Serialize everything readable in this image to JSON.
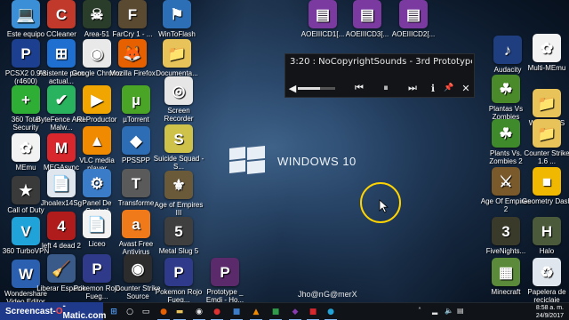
{
  "wallpaper": {
    "wordmark": "WINDOWS 10"
  },
  "media_widget": {
    "title": "3:20 : NoCopyrightSounds - 3rd Prototype &",
    "volume_fraction": 0.6
  },
  "watermark_names": [
    "Jho@n",
    "G@merX"
  ],
  "screencast_badge": {
    "prefix": "Screencast-",
    "o": "O",
    "suffix": "-Matic.com"
  },
  "clock": {
    "time": "8:58 a. m.",
    "date": "24/9/2017"
  },
  "icons": [
    {
      "id": "este-equipo",
      "label": "Este equipo",
      "color": "#3b8fd6",
      "glyph": "💻"
    },
    {
      "id": "ccleaner",
      "label": "CCleaner",
      "color": "#c0392b",
      "glyph": "C"
    },
    {
      "id": "area-51",
      "label": "Area-51",
      "color": "#2a3d2a",
      "glyph": "☠"
    },
    {
      "id": "farcry",
      "label": "FarCry 1 - ...",
      "color": "#5b4a32",
      "glyph": "F"
    },
    {
      "id": "wintoflash",
      "label": "WinToFlash",
      "color": "#2d6fb7",
      "glyph": "⚑"
    },
    {
      "id": "pcsx2",
      "label": "PCSX2 0.9.8 (r4600)",
      "color": "#1c3f8f",
      "glyph": "P"
    },
    {
      "id": "asistente",
      "label": "Asistente para actual...",
      "color": "#1f6fd0",
      "glyph": "⊞"
    },
    {
      "id": "google-chrome",
      "label": "Google Chrome",
      "color": "#e9e9e9",
      "glyph": "◉"
    },
    {
      "id": "mozilla-firefox",
      "label": "Mozilla Firefox",
      "color": "#e66000",
      "glyph": "🦊"
    },
    {
      "id": "documentos",
      "label": "Documenta...",
      "color": "#e8c35a",
      "glyph": "📁"
    },
    {
      "id": "360-total-security",
      "label": "360 Total Security",
      "color": "#2fae36",
      "glyph": "+"
    },
    {
      "id": "bytefence",
      "label": "ByteFence Anti-Malw...",
      "color": "#2ab35e",
      "glyph": "✔"
    },
    {
      "id": "reproductor",
      "label": "ReProductor",
      "color": "#f0a500",
      "glyph": "▶"
    },
    {
      "id": "utorrent",
      "label": "µTorrent",
      "color": "#4aa527",
      "glyph": "µ"
    },
    {
      "id": "screen-recorder",
      "label": "Screen Recorder",
      "color": "#e6e6e6",
      "glyph": "◎"
    },
    {
      "id": "memu",
      "label": "MEmu",
      "color": "#f2f2f2",
      "glyph": "✿"
    },
    {
      "id": "megasync",
      "label": "MEGAsync",
      "color": "#d9272e",
      "glyph": "M"
    },
    {
      "id": "vlc",
      "label": "VLC media player",
      "color": "#f08a00",
      "glyph": "▲"
    },
    {
      "id": "ppsspp",
      "label": "PPSSPP",
      "color": "#2d6db5",
      "glyph": "◆"
    },
    {
      "id": "suicide-squad",
      "label": "Suicide Squad - S...",
      "color": "#cfc24a",
      "glyph": "S"
    },
    {
      "id": "call-of-duty",
      "label": "Call of Duty",
      "color": "#3a3a3a",
      "glyph": "★"
    },
    {
      "id": "jhoalex",
      "label": "Jhoalex14Sg",
      "color": "#dfe6ee",
      "glyph": "📄"
    },
    {
      "id": "panel-de-control",
      "label": "Panel De Control",
      "color": "#3b7cc9",
      "glyph": "⚙"
    },
    {
      "id": "transformers",
      "label": "Transforme",
      "color": "#5a5a5a",
      "glyph": "T"
    },
    {
      "id": "age-of-empires-3",
      "label": "Age of Empires III",
      "color": "#6b5a3a",
      "glyph": "⚜"
    },
    {
      "id": "360-turbovpn",
      "label": "360 TurboVPN",
      "color": "#1fa3d8",
      "glyph": "V"
    },
    {
      "id": "left-4-dead-2",
      "label": "left 4 dead 2",
      "color": "#b01c1c",
      "glyph": "4"
    },
    {
      "id": "liceo",
      "label": "Liceo",
      "color": "#f2f2f2",
      "glyph": "📄"
    },
    {
      "id": "avast",
      "label": "Avast Free Antivirus",
      "color": "#f07a1a",
      "glyph": "a"
    },
    {
      "id": "metal-slug-5",
      "label": "Metal Slug 5",
      "color": "#3f3f3f",
      "glyph": "5"
    },
    {
      "id": "wondershare",
      "label": "Wondershare Video Editor",
      "color": "#2b5fb0",
      "glyph": "W"
    },
    {
      "id": "liberar-espacio",
      "label": "Liberar Espacio",
      "color": "#3a5b8a",
      "glyph": "🧹"
    },
    {
      "id": "pokemon-rojo-1",
      "label": "Pokemon Rojo Fueg...",
      "color": "#2f3a8a",
      "glyph": "P"
    },
    {
      "id": "counter-strike-source",
      "label": "Counter Strike Source",
      "color": "#2c2c2c",
      "glyph": "◉"
    },
    {
      "id": "pokemon-rojo-2",
      "label": "Pokemon Rojo Fueg...",
      "color": "#2f3a8a",
      "glyph": "P"
    },
    {
      "id": "prototype",
      "label": "Prototype _ Emdi - Ho...",
      "color": "#5a2a6a",
      "glyph": "P"
    },
    {
      "id": "aoe-cd1",
      "label": "AOEIIICD1[...",
      "color": "#7a3aa0",
      "glyph": "▤"
    },
    {
      "id": "aoe-cd3",
      "label": "AOEIIICD3[...",
      "color": "#7a3aa0",
      "glyph": "▤"
    },
    {
      "id": "aoe-cd2",
      "label": "AOEIIICD2[...",
      "color": "#7a3aa0",
      "glyph": "▤"
    },
    {
      "id": "audacity",
      "label": "Audacity",
      "color": "#1f3e80",
      "glyph": "♪"
    },
    {
      "id": "multi-memu",
      "label": "Multi-MEmu",
      "color": "#f2f2f2",
      "glyph": "✿"
    },
    {
      "id": "plantas-vs-zombies",
      "label": "Plantas Vs Zombies",
      "color": "#4a8a2a",
      "glyph": "☘"
    },
    {
      "id": "windows-folder",
      "label": "WINDOWS",
      "color": "#e8c35a",
      "glyph": "📁"
    },
    {
      "id": "plants-vs-zombies-2",
      "label": "Plants Vs. Zombies 2",
      "color": "#3f8a2a",
      "glyph": "☘"
    },
    {
      "id": "counter-strike-16",
      "label": "Counter Strike 1.6 ...",
      "color": "#e8c35a",
      "glyph": "📁"
    },
    {
      "id": "age-of-empires-2",
      "label": "Age Of Empires 2",
      "color": "#7a5a2a",
      "glyph": "⚔"
    },
    {
      "id": "geometry-dash",
      "label": "Geometry Dash",
      "color": "#f0b800",
      "glyph": "■"
    },
    {
      "id": "fivenights",
      "label": "FiveNights...",
      "color": "#3a3a2a",
      "glyph": "3"
    },
    {
      "id": "halo",
      "label": "Halo",
      "color": "#4a5a3a",
      "glyph": "H"
    },
    {
      "id": "minecraft",
      "label": "Minecraft",
      "color": "#5a8a3a",
      "glyph": "▦"
    },
    {
      "id": "papelera",
      "label": "Papelera de reciclaje",
      "color": "#dfe6ee",
      "glyph": "♻"
    }
  ],
  "taskbar_icons": [
    {
      "id": "start",
      "glyph": "⊞",
      "color": "#4fa0ff"
    },
    {
      "id": "search",
      "glyph": "○",
      "color": "#ffffff"
    },
    {
      "id": "task-view",
      "glyph": "▭",
      "color": "#ffffff"
    },
    {
      "id": "firefox",
      "glyph": "●",
      "color": "#e66000"
    },
    {
      "id": "explorer",
      "glyph": "▬",
      "color": "#e8c35a"
    },
    {
      "id": "chrome",
      "glyph": "◉",
      "color": "#e9e9e9"
    },
    {
      "id": "record",
      "glyph": "●",
      "color": "#e03030"
    },
    {
      "id": "app1",
      "glyph": "■",
      "color": "#3b7cc9"
    },
    {
      "id": "app2",
      "glyph": "▲",
      "color": "#f08a00"
    },
    {
      "id": "app3",
      "glyph": "■",
      "color": "#2f9a4a"
    },
    {
      "id": "app4",
      "glyph": "◆",
      "color": "#8a3ab0"
    },
    {
      "id": "app5",
      "glyph": "■",
      "color": "#d9272e"
    },
    {
      "id": "app6",
      "glyph": "●",
      "color": "#1fa3d8"
    }
  ]
}
